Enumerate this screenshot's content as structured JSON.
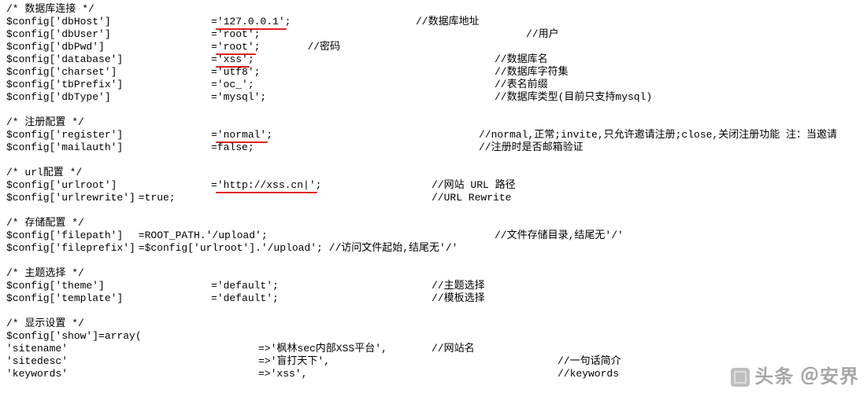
{
  "sections": {
    "db": {
      "title": "/* 数据库连接 */",
      "rows": [
        {
          "key": "$config['dbHost']",
          "op": "=",
          "val": "'127.0.0.1'",
          "end": ";",
          "comment": "//数据库地址",
          "underline": true,
          "ctab": 520
        },
        {
          "key": "$config['dbUser']",
          "op": "=",
          "val": "'root'",
          "end": ";",
          "comment": "//用户",
          "ctab": 660
        },
        {
          "key": "$config['dbPwd']",
          "op": "=",
          "val": "'root'",
          "end": ";",
          "mid": "//密码",
          "underline": true
        },
        {
          "key": "$config['database']",
          "op": "=",
          "val": "'xss'",
          "end": ";",
          "comment": "//数据库名",
          "underline": true,
          "ctab": 620
        },
        {
          "key": "$config['charset']",
          "op": "=",
          "val": "'utf8'",
          "end": ";",
          "comment": "//数据库字符集",
          "ctab": 620
        },
        {
          "key": "$config['tbPrefix']",
          "op": "=",
          "val": "'oc_'",
          "end": ";",
          "comment": "//表名前缀",
          "ctab": 620
        },
        {
          "key": "$config['dbType']",
          "op": "=",
          "val": "'mysql'",
          "end": ";",
          "comment": "//数据库类型(目前只支持mysql)",
          "ctab": 620
        }
      ]
    },
    "reg": {
      "title": "/* 注册配置 */",
      "rows": [
        {
          "key": "$config['register']",
          "op": "=",
          "val": "'normal'",
          "end": ";",
          "comment": "//normal,正常;invite,只允许邀请注册;close,关闭注册功能  注：当邀请",
          "underline": true,
          "ctab": 600
        },
        {
          "key": "$config['mailauth']",
          "op": "=",
          "val": "false",
          "end": ";",
          "comment": "//注册时是否邮箱验证",
          "ctab": 600
        }
      ]
    },
    "url": {
      "title": "/* url配置 */",
      "rows": [
        {
          "key": "$config['urlroot']",
          "op": "=",
          "val": "'http://xss.cn|'",
          "end": ";",
          "comment": "//网站 URL 路径",
          "underline": true,
          "ctab": 540
        },
        {
          "key": "$config['urlrewrite']",
          "op": "",
          "keypad": 160,
          "full": "   =true;",
          "comment": "//URL Rewrite",
          "ctab": 540
        }
      ]
    },
    "store": {
      "title": "/* 存储配置 */",
      "rows": [
        {
          "key": "$config['filepath']",
          "op": "",
          "full": "        =ROOT_PATH.'/upload';",
          "comment": "//文件存储目录,结尾无'/'",
          "ctab": 620
        },
        {
          "key": "$config['fileprefix']",
          "op": "",
          "full": "  =$config['urlroot'].'/upload';  //访问文件起始,结尾无'/'",
          "comment": "",
          "ctab": 0
        }
      ]
    },
    "theme": {
      "title": "/* 主题选择 */",
      "rows": [
        {
          "key": "$config['theme']",
          "op": "=",
          "val": "'default'",
          "end": ";",
          "comment": "//主题选择",
          "ctab": 540
        },
        {
          "key": "$config['template']",
          "op": "=",
          "val": "'default'",
          "end": ";",
          "comment": "//模板选择",
          "ctab": 540
        }
      ]
    },
    "show": {
      "title": "/* 显示设置 */",
      "open": "$config['show']=array(",
      "rows": [
        {
          "key": "        'sitename'",
          "arrow": "=>",
          "val": "'枫林sec内部XSS平台'",
          "end": ",",
          "comment": "//网站名",
          "ctab": 540
        },
        {
          "key": "        'sitedesc'",
          "arrow": "=>",
          "val": "'盲打天下'",
          "end": ",",
          "comment": "//一句话简介",
          "ctab": 700
        },
        {
          "key": "        'keywords'",
          "arrow": "=>",
          "val": "'xss'",
          "end": ",",
          "comment": "//keywords",
          "ctab": 700
        }
      ]
    }
  },
  "watermark": "头条 ＠安界"
}
